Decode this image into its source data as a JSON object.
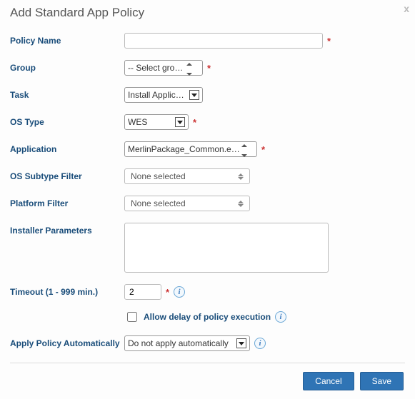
{
  "dialog": {
    "title": "Add Standard App Policy",
    "close_label": "x"
  },
  "labels": {
    "policy_name": "Policy Name",
    "group": "Group",
    "task": "Task",
    "os_type": "OS Type",
    "application": "Application",
    "os_subtype_filter": "OS Subtype Filter",
    "platform_filter": "Platform Filter",
    "installer_parameters": "Installer Parameters",
    "timeout": "Timeout (1 - 999 min.)",
    "allow_delay": "Allow delay of policy execution",
    "apply_policy": "Apply Policy Automatically"
  },
  "values": {
    "policy_name": "",
    "group": "-- Select group --",
    "task": "Install Application",
    "os_type": "WES",
    "application": "MerlinPackage_Common.exe (Loc",
    "os_subtype_filter": "None selected",
    "platform_filter": "None selected",
    "installer_parameters": "",
    "timeout": "2",
    "allow_delay_checked": false,
    "apply_policy": "Do not apply automatically"
  },
  "required_marker": "*",
  "buttons": {
    "cancel": "Cancel",
    "save": "Save"
  }
}
